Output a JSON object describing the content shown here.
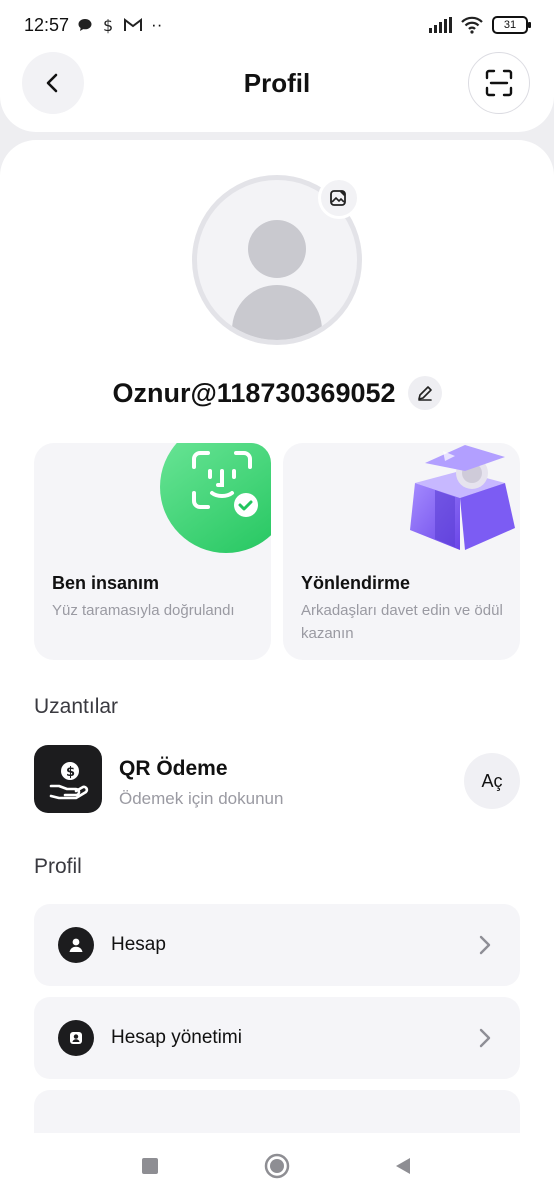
{
  "status_bar": {
    "time": "12:57",
    "dots": "··",
    "battery": "31"
  },
  "header": {
    "title": "Profil"
  },
  "profile": {
    "username": "Oznur@118730369052"
  },
  "cards": [
    {
      "title": "Ben insanım",
      "subtitle": "Yüz taramasıyla doğrulandı"
    },
    {
      "title": "Yönlendirme",
      "subtitle": "Arkadaşları davet edin ve ödül kazanın"
    }
  ],
  "extensions": {
    "section_title": "Uzantılar",
    "item": {
      "title": "QR Ödeme",
      "subtitle": "Ödemek için dokunun",
      "action_label": "Aç"
    }
  },
  "profile_section": {
    "section_title": "Profil",
    "items": [
      {
        "label": "Hesap",
        "icon": "user-icon"
      },
      {
        "label": "Hesap yönetimi",
        "icon": "account-manage-icon"
      }
    ]
  },
  "colors": {
    "accent_green": "#22c55e",
    "gift_purple": "#8b6cf6",
    "dark": "#1c1c1e"
  }
}
